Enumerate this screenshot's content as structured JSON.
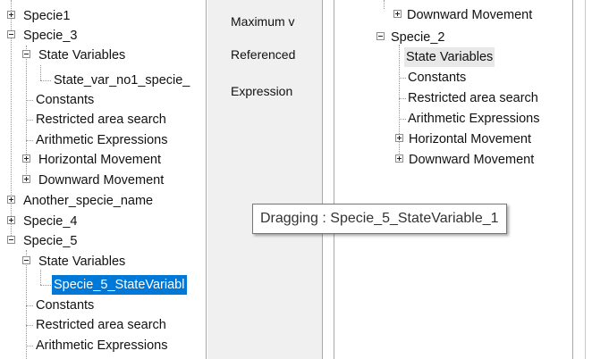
{
  "left_tree": {
    "specie1": "Specie1",
    "specie3": "Specie_3",
    "specie3_state_vars": "State Variables",
    "specie3_state_var_item": "State_var_no1_specie_",
    "specie3_constants": "Constants",
    "specie3_restricted": "Restricted area search",
    "specie3_arith": "Arithmetic Expressions",
    "specie3_horizontal": "Horizontal Movement",
    "specie3_downward": "Downward Movement",
    "another_specie": "Another_specie_name",
    "specie4": "Specie_4",
    "specie5": "Specie_5",
    "specie5_state_vars": "State Variables",
    "specie5_state_var_item": "Specie_5_StateVariabl",
    "specie5_constants": "Constants",
    "specie5_restricted": "Restricted area search",
    "specie5_arith": "Arithmetic Expressions"
  },
  "middle_panel": {
    "maximum": "Maximum v",
    "referenced": "Referenced",
    "expression": "Expression"
  },
  "right_tree": {
    "downward_top": "Downward Movement",
    "specie2": "Specie_2",
    "state_vars": "State Variables",
    "constants": "Constants",
    "restricted": "Restricted area search",
    "arith": "Arithmetic Expressions",
    "horizontal": "Horizontal Movement",
    "downward": "Downward Movement"
  },
  "drag_tooltip": "Dragging : Specie_5_StateVariable_1",
  "colors": {
    "selection": "#0078d7",
    "hover_highlight": "#e8e8e8",
    "middle_panel_bg": "#f0f0f0"
  }
}
